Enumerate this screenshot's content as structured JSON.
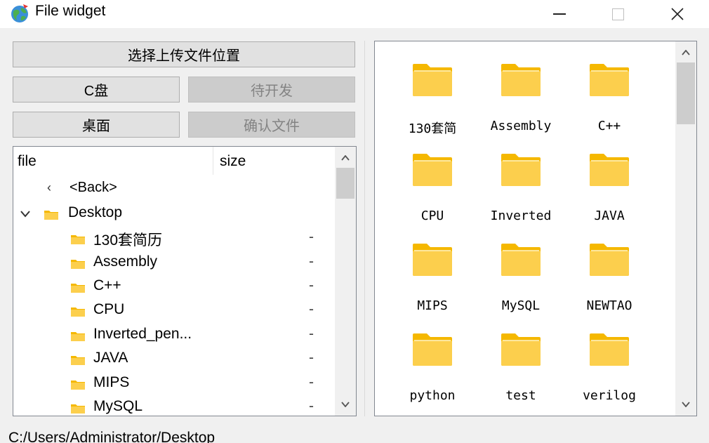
{
  "window": {
    "title": "File widget",
    "app_icon": "globe-icon"
  },
  "buttons": {
    "select_location": "选择上传文件位置",
    "c_drive": "C盘",
    "pending": "待开发",
    "desktop": "桌面",
    "confirm_file": "确认文件"
  },
  "tree": {
    "columns": {
      "file": "file",
      "size": "size"
    },
    "back": "<Back>",
    "root": "Desktop",
    "items": [
      {
        "name": "130套简历",
        "size": "-"
      },
      {
        "name": "Assembly",
        "size": "-"
      },
      {
        "name": "C++",
        "size": "-"
      },
      {
        "name": "CPU",
        "size": "-"
      },
      {
        "name": "Inverted_pen...",
        "size": "-"
      },
      {
        "name": "JAVA",
        "size": "-"
      },
      {
        "name": "MIPS",
        "size": "-"
      },
      {
        "name": "MySQL",
        "size": "-"
      }
    ]
  },
  "grid": {
    "items": [
      "130套简",
      "Assembly",
      "C++",
      "CPU",
      "Inverted",
      "JAVA",
      "MIPS",
      "MySQL",
      "NEWTAO",
      "python",
      "test",
      "verilog"
    ]
  },
  "status": {
    "path": "C:/Users/Administrator/Desktop"
  },
  "colors": {
    "folder": "#fccf4d",
    "folder_dark": "#f5b800",
    "accent": "#0078d7"
  }
}
